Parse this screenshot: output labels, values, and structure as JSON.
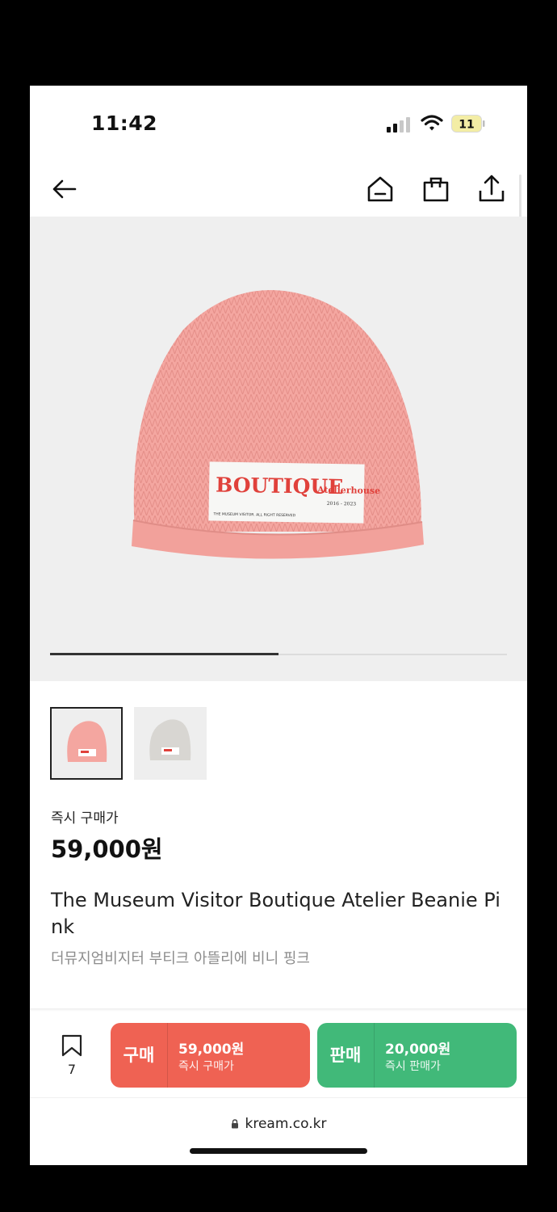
{
  "status_bar": {
    "time": "11:42",
    "battery": "11"
  },
  "nav": {
    "back_icon": "arrow-left-icon",
    "home_icon": "home-icon",
    "bag_icon": "shopping-bag-icon",
    "share_icon": "share-icon"
  },
  "hero": {
    "patch_brand": "BOUTIQUE",
    "patch_sub": "Atelierhouse",
    "patch_years": "2016 - 2023",
    "patch_footer": "THE MUSEUM VISITOR. ALL RIGHT RESERVED",
    "colors": {
      "beanie": "#f4a6a0",
      "patch_text": "#e0413b"
    },
    "carousel_progress": 0.5
  },
  "product": {
    "price_label": "즉시 구매가",
    "price": "59,000원",
    "title": "The Museum Visitor Boutique Atelier Beanie Pink",
    "subtitle": "더뮤지엄비지터 부티크 아뜰리에 비니 핑크"
  },
  "bottom": {
    "bookmark_count": "7",
    "buy": {
      "label": "구매",
      "price": "59,000원",
      "sub": "즉시 구매가",
      "color": "#ef6253"
    },
    "sell": {
      "label": "판매",
      "price": "20,000원",
      "sub": "즉시 판매가",
      "color": "#41b979"
    }
  },
  "browser": {
    "url": "kream.co.kr"
  }
}
